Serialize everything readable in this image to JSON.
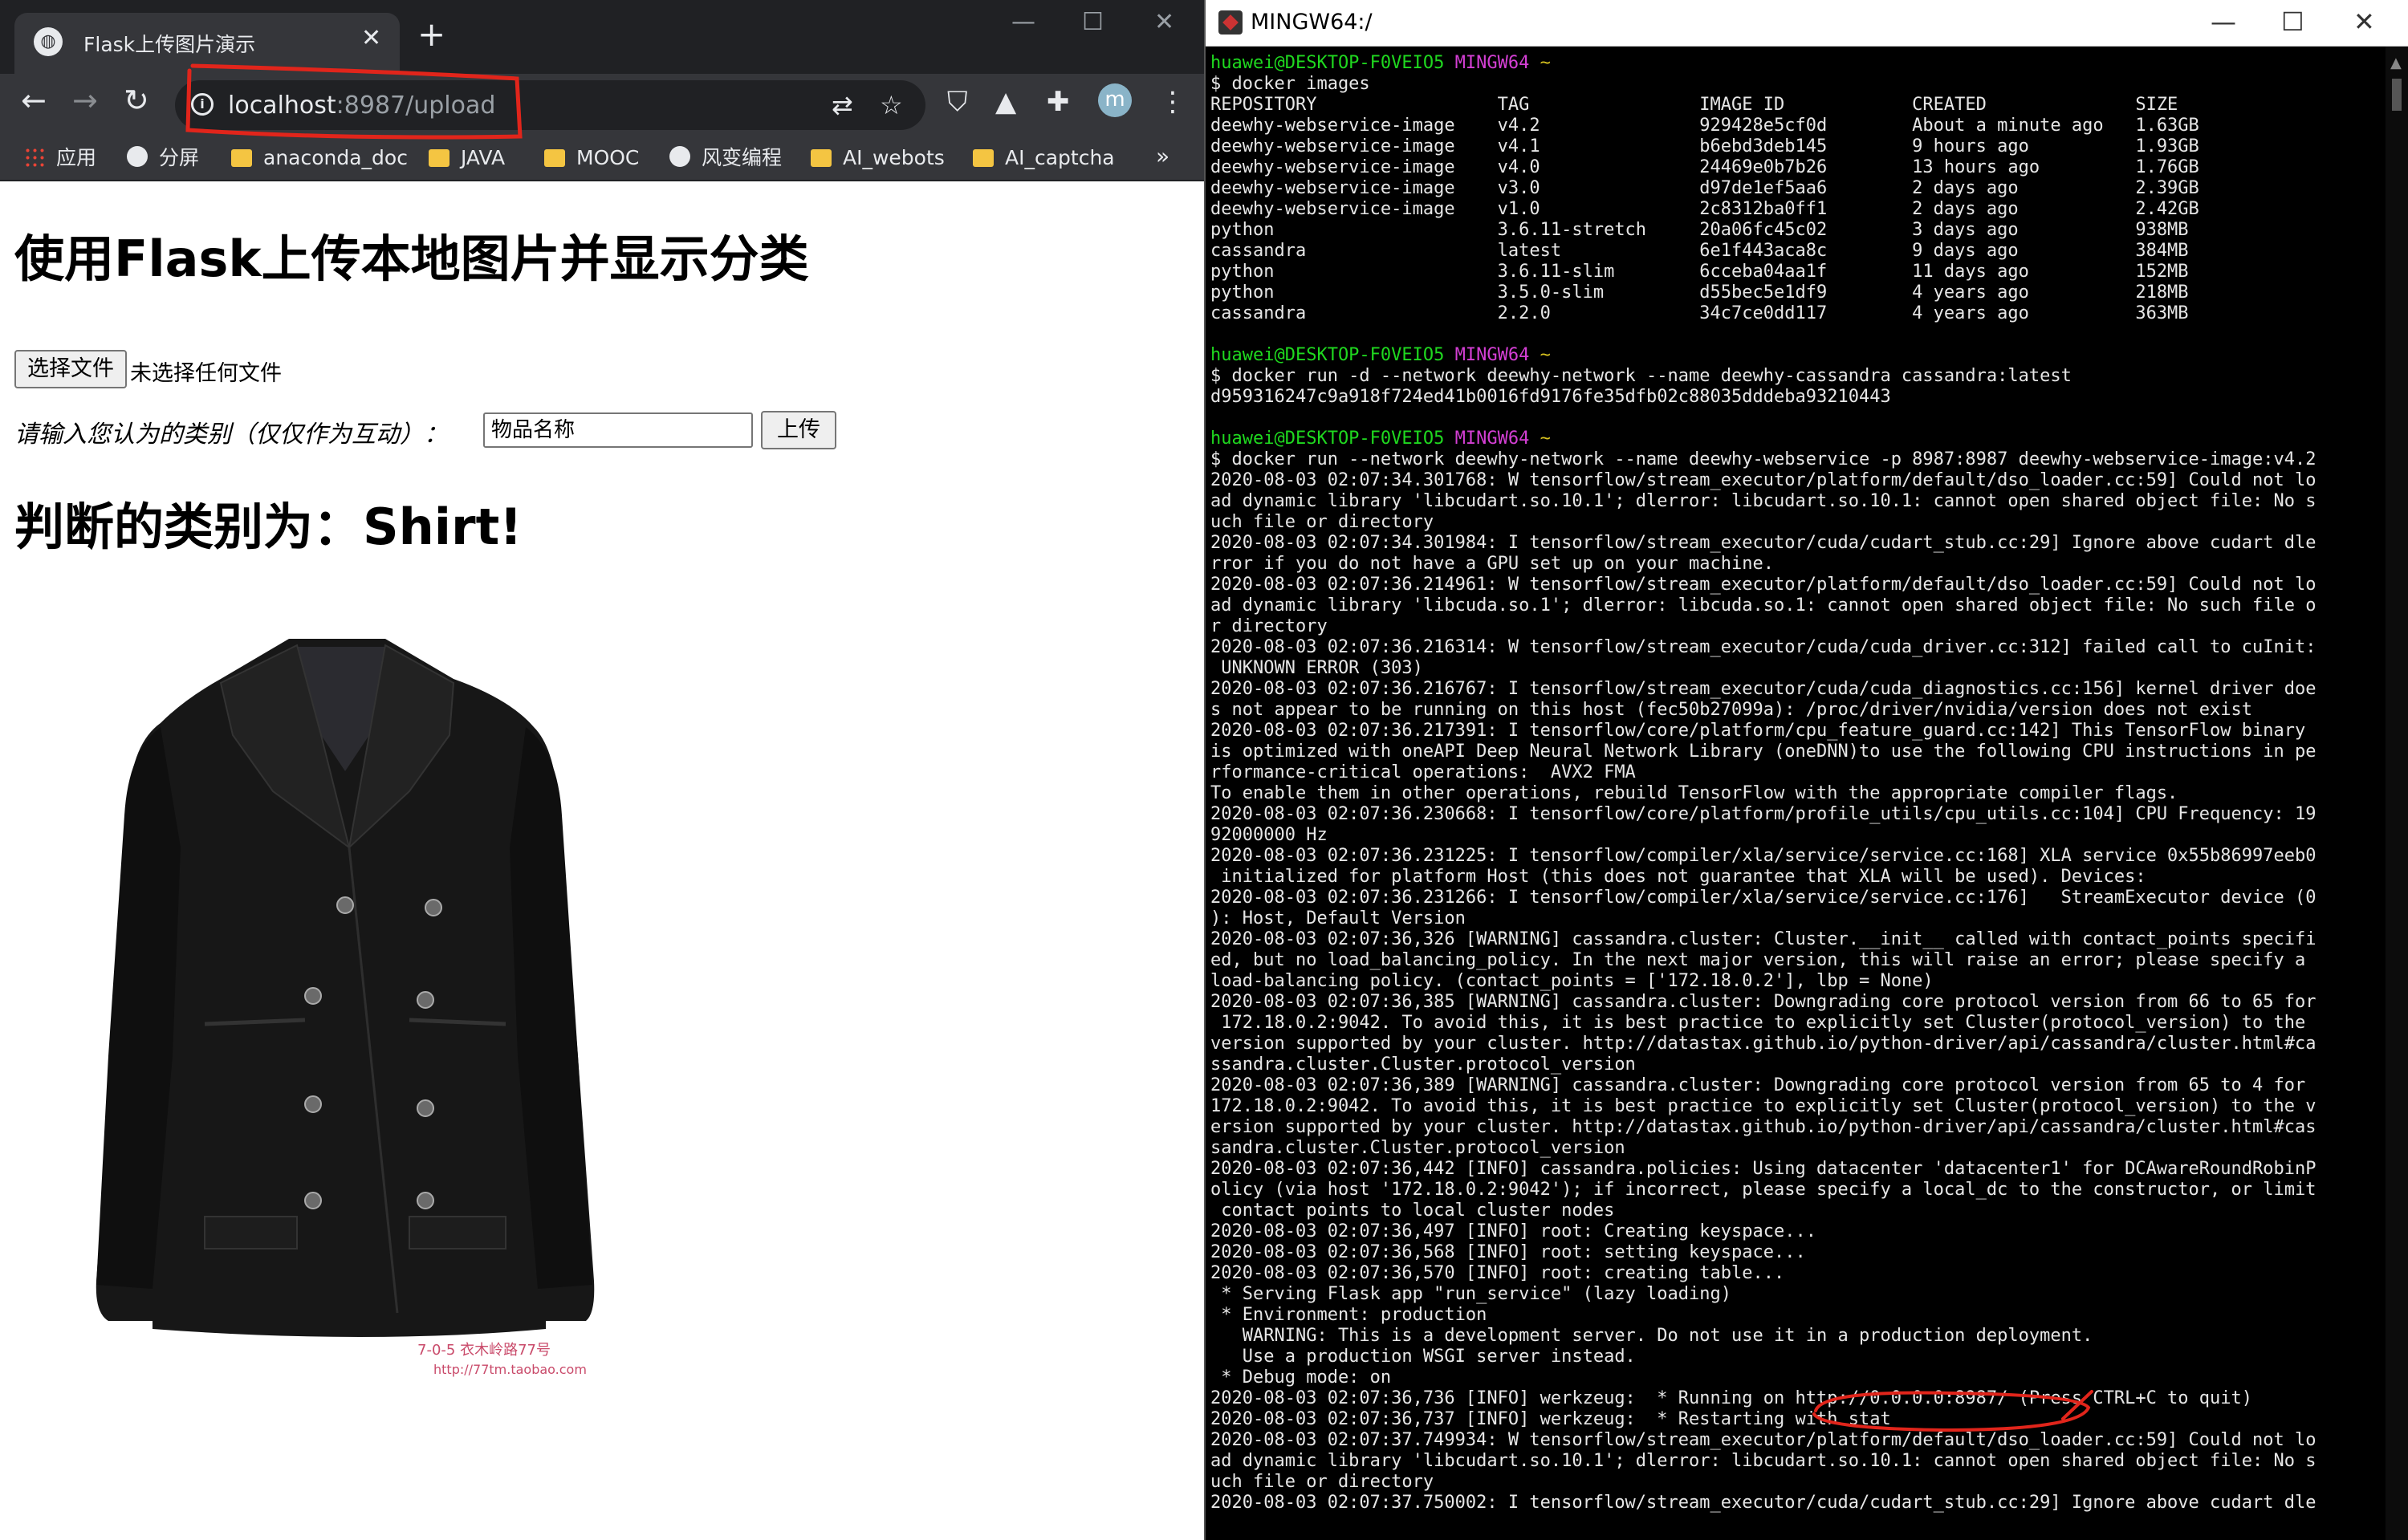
{
  "browser": {
    "tab_title": "Flask上传图片演示",
    "url_host": "localhost",
    "url_rest": ":8987/upload",
    "avatar_letter": "m",
    "bookmarks": [
      "应用",
      "分屏",
      "anaconda_doc",
      "JAVA",
      "MOOC",
      "风变编程",
      "AI_webots",
      "AI_captcha"
    ],
    "bookmarks_more": "»"
  },
  "page": {
    "heading": "使用Flask上传本地图片并显示分类",
    "file_button": "选择文件",
    "file_status": "未选择任何文件",
    "prompt": "请输入您认为的类别（仅仅作为互动）：",
    "input_placeholder": "物品名称",
    "upload_button": "上传",
    "result": "判断的类别为：Shirt!",
    "image_watermark_1": "7-0-5 衣木岭路77号",
    "image_watermark_2": "http://77tm.taobao.com"
  },
  "terminal": {
    "title": "MINGW64:/",
    "prompt_user": "huawei@DESKTOP-F0VEIO5",
    "prompt_sys": "MINGW64",
    "prompt_path": "~",
    "lines": [
      {
        "t": "prompt"
      },
      {
        "t": "text",
        "v": "$ docker images"
      },
      {
        "t": "text",
        "v": "REPOSITORY                 TAG                IMAGE ID            CREATED              SIZE"
      },
      {
        "t": "text",
        "v": "deewhy-webservice-image    v4.2               929428e5cf0d        About a minute ago   1.63GB"
      },
      {
        "t": "text",
        "v": "deewhy-webservice-image    v4.1               b6ebd3deb145        9 hours ago          1.93GB"
      },
      {
        "t": "text",
        "v": "deewhy-webservice-image    v4.0               24469e0b7b26        13 hours ago         1.76GB"
      },
      {
        "t": "text",
        "v": "deewhy-webservice-image    v3.0               d97de1ef5aa6        2 days ago           2.39GB"
      },
      {
        "t": "text",
        "v": "deewhy-webservice-image    v1.0               2c8312ba0ff1        2 days ago           2.42GB"
      },
      {
        "t": "text",
        "v": "python                     3.6.11-stretch     20a06fc45c02        3 days ago           938MB"
      },
      {
        "t": "text",
        "v": "cassandra                  latest             6e1f443aca8c        9 days ago           384MB"
      },
      {
        "t": "text",
        "v": "python                     3.6.11-slim        6cceba04aa1f        11 days ago          152MB"
      },
      {
        "t": "text",
        "v": "python                     3.5.0-slim         d55bec5e1df9        4 years ago          218MB"
      },
      {
        "t": "text",
        "v": "cassandra                  2.2.0              34c7ce0dd117        4 years ago          363MB"
      },
      {
        "t": "text",
        "v": ""
      },
      {
        "t": "prompt"
      },
      {
        "t": "text",
        "v": "$ docker run -d --network deewhy-network --name deewhy-cassandra cassandra:latest"
      },
      {
        "t": "text",
        "v": "d959316247c9a918f724ed41b0016fd9176fe35dfb02c88035dddeba93210443"
      },
      {
        "t": "text",
        "v": ""
      },
      {
        "t": "prompt"
      },
      {
        "t": "text",
        "v": "$ docker run --network deewhy-network --name deewhy-webservice -p 8987:8987 deewhy-webservice-image:v4.2"
      },
      {
        "t": "text",
        "v": "2020-08-03 02:07:34.301768: W tensorflow/stream_executor/platform/default/dso_loader.cc:59] Could not lo"
      },
      {
        "t": "text",
        "v": "ad dynamic library 'libcudart.so.10.1'; dlerror: libcudart.so.10.1: cannot open shared object file: No s"
      },
      {
        "t": "text",
        "v": "uch file or directory"
      },
      {
        "t": "text",
        "v": "2020-08-03 02:07:34.301984: I tensorflow/stream_executor/cuda/cudart_stub.cc:29] Ignore above cudart dle"
      },
      {
        "t": "text",
        "v": "rror if you do not have a GPU set up on your machine."
      },
      {
        "t": "text",
        "v": "2020-08-03 02:07:36.214961: W tensorflow/stream_executor/platform/default/dso_loader.cc:59] Could not lo"
      },
      {
        "t": "text",
        "v": "ad dynamic library 'libcuda.so.1'; dlerror: libcuda.so.1: cannot open shared object file: No such file o"
      },
      {
        "t": "text",
        "v": "r directory"
      },
      {
        "t": "text",
        "v": "2020-08-03 02:07:36.216314: W tensorflow/stream_executor/cuda/cuda_driver.cc:312] failed call to cuInit:"
      },
      {
        "t": "text",
        "v": " UNKNOWN ERROR (303)"
      },
      {
        "t": "text",
        "v": "2020-08-03 02:07:36.216767: I tensorflow/stream_executor/cuda/cuda_diagnostics.cc:156] kernel driver doe"
      },
      {
        "t": "text",
        "v": "s not appear to be running on this host (fec50b27099a): /proc/driver/nvidia/version does not exist"
      },
      {
        "t": "text",
        "v": "2020-08-03 02:07:36.217391: I tensorflow/core/platform/cpu_feature_guard.cc:142] This TensorFlow binary"
      },
      {
        "t": "text",
        "v": "is optimized with oneAPI Deep Neural Network Library (oneDNN)to use the following CPU instructions in pe"
      },
      {
        "t": "text",
        "v": "rformance-critical operations:  AVX2 FMA"
      },
      {
        "t": "text",
        "v": "To enable them in other operations, rebuild TensorFlow with the appropriate compiler flags."
      },
      {
        "t": "text",
        "v": "2020-08-03 02:07:36.230668: I tensorflow/core/platform/profile_utils/cpu_utils.cc:104] CPU Frequency: 19"
      },
      {
        "t": "text",
        "v": "92000000 Hz"
      },
      {
        "t": "text",
        "v": "2020-08-03 02:07:36.231225: I tensorflow/compiler/xla/service/service.cc:168] XLA service 0x55b86997eeb0"
      },
      {
        "t": "text",
        "v": " initialized for platform Host (this does not guarantee that XLA will be used). Devices:"
      },
      {
        "t": "text",
        "v": "2020-08-03 02:07:36.231266: I tensorflow/compiler/xla/service/service.cc:176]   StreamExecutor device (0"
      },
      {
        "t": "text",
        "v": "): Host, Default Version"
      },
      {
        "t": "text",
        "v": "2020-08-03 02:07:36,326 [WARNING] cassandra.cluster: Cluster.__init__ called with contact_points specifi"
      },
      {
        "t": "text",
        "v": "ed, but no load_balancing_policy. In the next major version, this will raise an error; please specify a"
      },
      {
        "t": "text",
        "v": "load-balancing policy. (contact_points = ['172.18.0.2'], lbp = None)"
      },
      {
        "t": "text",
        "v": "2020-08-03 02:07:36,385 [WARNING] cassandra.cluster: Downgrading core protocol version from 66 to 65 for"
      },
      {
        "t": "text",
        "v": " 172.18.0.2:9042. To avoid this, it is best practice to explicitly set Cluster(protocol_version) to the"
      },
      {
        "t": "text",
        "v": "version supported by your cluster. http://datastax.github.io/python-driver/api/cassandra/cluster.html#ca"
      },
      {
        "t": "text",
        "v": "ssandra.cluster.Cluster.protocol_version"
      },
      {
        "t": "text",
        "v": "2020-08-03 02:07:36,389 [WARNING] cassandra.cluster: Downgrading core protocol version from 65 to 4 for"
      },
      {
        "t": "text",
        "v": "172.18.0.2:9042. To avoid this, it is best practice to explicitly set Cluster(protocol_version) to the v"
      },
      {
        "t": "text",
        "v": "ersion supported by your cluster. http://datastax.github.io/python-driver/api/cassandra/cluster.html#cas"
      },
      {
        "t": "text",
        "v": "sandra.cluster.Cluster.protocol_version"
      },
      {
        "t": "text",
        "v": "2020-08-03 02:07:36,442 [INFO] cassandra.policies: Using datacenter 'datacenter1' for DCAwareRoundRobinP"
      },
      {
        "t": "text",
        "v": "olicy (via host '172.18.0.2:9042'); if incorrect, please specify a local_dc to the constructor, or limit"
      },
      {
        "t": "text",
        "v": " contact points to local cluster nodes"
      },
      {
        "t": "text",
        "v": "2020-08-03 02:07:36,497 [INFO] root: Creating keyspace..."
      },
      {
        "t": "text",
        "v": "2020-08-03 02:07:36,568 [INFO] root: setting keyspace..."
      },
      {
        "t": "text",
        "v": "2020-08-03 02:07:36,570 [INFO] root: creating table..."
      },
      {
        "t": "text",
        "v": " * Serving Flask app \"run_service\" (lazy loading)"
      },
      {
        "t": "text",
        "v": " * Environment: production"
      },
      {
        "t": "text",
        "v": "   WARNING: This is a development server. Do not use it in a production deployment."
      },
      {
        "t": "text",
        "v": "   Use a production WSGI server instead."
      },
      {
        "t": "text",
        "v": " * Debug mode: on"
      },
      {
        "t": "text",
        "v": "2020-08-03 02:07:36,736 [INFO] werkzeug:  * Running on http://0.0.0.0:8987/ (Press CTRL+C to quit)"
      },
      {
        "t": "text",
        "v": "2020-08-03 02:07:36,737 [INFO] werkzeug:  * Restarting with stat"
      },
      {
        "t": "text",
        "v": "2020-08-03 02:07:37.749934: W tensorflow/stream_executor/platform/default/dso_loader.cc:59] Could not lo"
      },
      {
        "t": "text",
        "v": "ad dynamic library 'libcudart.so.10.1'; dlerror: libcudart.so.10.1: cannot open shared object file: No s"
      },
      {
        "t": "text",
        "v": "uch file or directory"
      },
      {
        "t": "text",
        "v": "2020-08-03 02:07:37.750002: I tensorflow/stream_executor/cuda/cudart_stub.cc:29] Ignore above cudart dle"
      }
    ]
  }
}
